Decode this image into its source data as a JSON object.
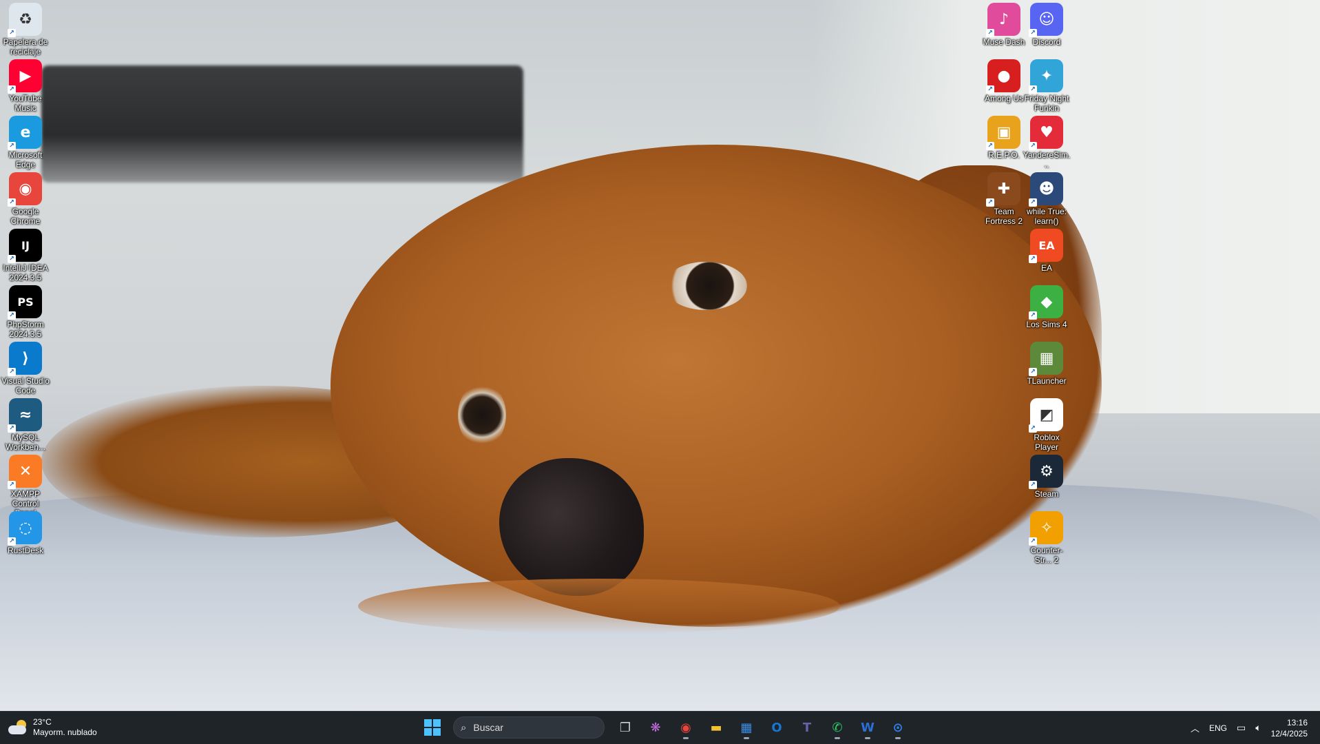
{
  "desktop": {
    "left_icons": [
      {
        "label": "Papelera de reciclaje",
        "icon": "recycle-bin-icon",
        "color": "#dfe7ee",
        "glyph": "♻"
      },
      {
        "label": "YouTube Music",
        "icon": "youtube-music-icon",
        "color": "#ff0033",
        "glyph": "▶"
      },
      {
        "label": "Microsoft Edge",
        "icon": "edge-icon",
        "color": "#1a9be0",
        "glyph": "e"
      },
      {
        "label": "Google Chrome",
        "icon": "chrome-icon",
        "color": "#e8453c",
        "glyph": "◉"
      },
      {
        "label": "IntelliJ IDEA 2024.3.5",
        "icon": "intellij-icon",
        "color": "#000000",
        "glyph": "IJ"
      },
      {
        "label": "PhpStorm 2024.3.5",
        "icon": "phpstorm-icon",
        "color": "#000000",
        "glyph": "PS"
      },
      {
        "label": "Visual Studio Code",
        "icon": "vscode-icon",
        "color": "#0a7acc",
        "glyph": "⟩"
      },
      {
        "label": "MySQL Workben...",
        "icon": "mysql-workbench-icon",
        "color": "#1d5b80",
        "glyph": "≈"
      },
      {
        "label": "XAMPP Control Panel",
        "icon": "xampp-icon",
        "color": "#fb7a24",
        "glyph": "✕"
      },
      {
        "label": "RustDesk",
        "icon": "rustdesk-icon",
        "color": "#2496e8",
        "glyph": "◌"
      }
    ],
    "right_col1_icons": [
      {
        "label": "Muse Dash",
        "icon": "muse-dash-icon",
        "color": "#e04b9b",
        "glyph": "♪"
      },
      {
        "label": "Among Us",
        "icon": "among-us-icon",
        "color": "#d81f1f",
        "glyph": "●"
      },
      {
        "label": "R.E.P.O.",
        "icon": "repo-icon",
        "color": "#e9a21b",
        "glyph": "▣"
      },
      {
        "label": "Team Fortress 2",
        "icon": "tf2-icon",
        "color": "#8a4a1e",
        "glyph": "✚"
      }
    ],
    "right_col2_icons": [
      {
        "label": "Discord",
        "icon": "discord-icon",
        "color": "#5865f2",
        "glyph": "☺"
      },
      {
        "label": "Friday Night Funkin",
        "icon": "fnf-icon",
        "color": "#31a4d8",
        "glyph": "✦"
      },
      {
        "label": "YandereSim...",
        "icon": "yandere-sim-icon",
        "color": "#e32b3a",
        "glyph": "♥"
      },
      {
        "label": "while True: learn()",
        "icon": "while-true-learn-icon",
        "color": "#2b4a7a",
        "glyph": "☻"
      },
      {
        "label": "EA",
        "icon": "ea-icon",
        "color": "#f04a23",
        "glyph": "EA"
      },
      {
        "label": "Los Sims 4",
        "icon": "sims4-icon",
        "color": "#3cb043",
        "glyph": "◆"
      },
      {
        "label": "TLauncher",
        "icon": "tlauncher-icon",
        "color": "#5c8a3a",
        "glyph": "▦"
      },
      {
        "label": "Roblox Player",
        "icon": "roblox-icon",
        "color": "#ffffff",
        "glyph": "◩"
      },
      {
        "label": "Steam",
        "icon": "steam-icon",
        "color": "#1b2838",
        "glyph": "⚙"
      },
      {
        "label": "Counter-Str... 2",
        "icon": "counter-strike-icon",
        "color": "#f1a000",
        "glyph": "✧"
      }
    ]
  },
  "taskbar": {
    "weather": {
      "temp": "23°C",
      "desc": "Mayorm. nublado"
    },
    "search": {
      "placeholder": "Buscar"
    },
    "pinned": [
      {
        "name": "task-view-icon",
        "glyph": "❐",
        "color": "#d0d0d0",
        "running": false
      },
      {
        "name": "copilot-icon",
        "glyph": "❋",
        "color": "#c56ce0",
        "running": false
      },
      {
        "name": "chrome-taskbar-icon",
        "glyph": "◉",
        "color": "#e8453c",
        "running": true
      },
      {
        "name": "file-explorer-icon",
        "glyph": "▬",
        "color": "#f2c230",
        "running": false
      },
      {
        "name": "microsoft-store-icon",
        "glyph": "▦",
        "color": "#3a8ee6",
        "running": true
      },
      {
        "name": "outlook-icon",
        "glyph": "O",
        "color": "#1677d4",
        "running": false
      },
      {
        "name": "teams-icon",
        "glyph": "T",
        "color": "#6264a7",
        "running": false
      },
      {
        "name": "whatsapp-icon",
        "glyph": "✆",
        "color": "#25d366",
        "running": true
      },
      {
        "name": "word-icon",
        "glyph": "W",
        "color": "#2b6fd6",
        "running": true
      },
      {
        "name": "remote-desktop-icon",
        "glyph": "⊙",
        "color": "#2f7fe8",
        "running": true
      }
    ],
    "tray": {
      "language": "ENG",
      "time": "13:16",
      "date": "12/4/2025"
    }
  }
}
